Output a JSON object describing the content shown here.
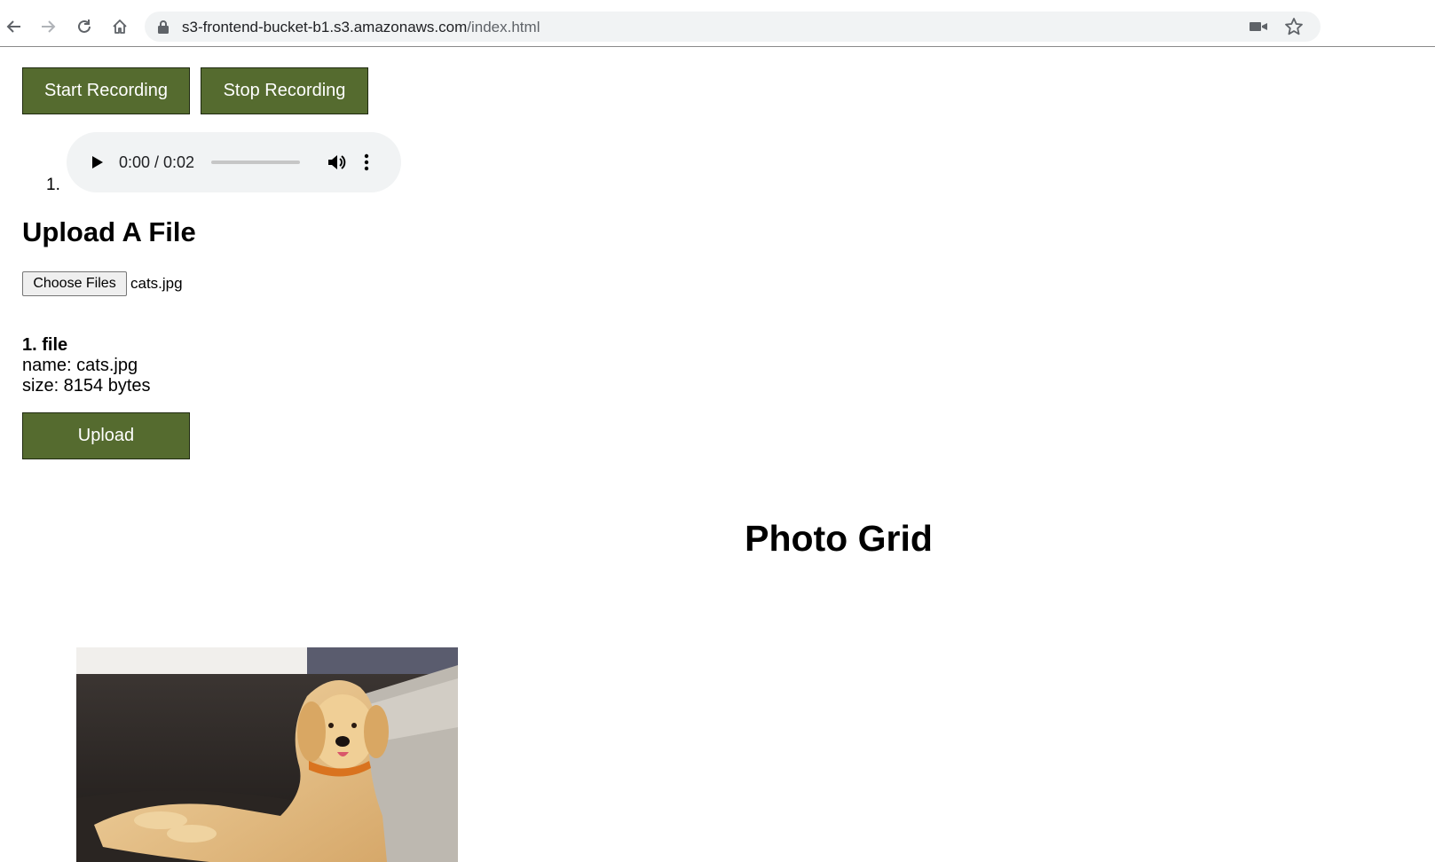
{
  "browser": {
    "url_host": "s3-frontend-bucket-b1.s3.amazonaws.com",
    "url_path": "/index.html",
    "icons": {
      "back": "back-arrow-icon",
      "forward": "forward-arrow-icon",
      "reload": "reload-icon",
      "home": "home-icon",
      "lock": "lock-icon",
      "camera": "camera-icon",
      "bookmark": "star-icon"
    }
  },
  "recording": {
    "start_label": "Start Recording",
    "stop_label": "Stop Recording"
  },
  "recordings_list": [
    {
      "index": "1.",
      "time_display": "0:00 / 0:02",
      "progress": 0.0
    }
  ],
  "upload": {
    "heading": "Upload A File",
    "choose_label": "Choose Files",
    "chosen_file": "cats.jpg",
    "file_entry": {
      "title": "1. file",
      "name_line": "name: cats.jpg",
      "size_line": "size: 8154 bytes"
    },
    "upload_label": "Upload"
  },
  "photo_grid": {
    "heading": "Photo Grid"
  },
  "colors": {
    "button_green": "#556b2f",
    "omnibox_bg": "#f1f3f4",
    "audio_bg": "#f1f3f4"
  }
}
